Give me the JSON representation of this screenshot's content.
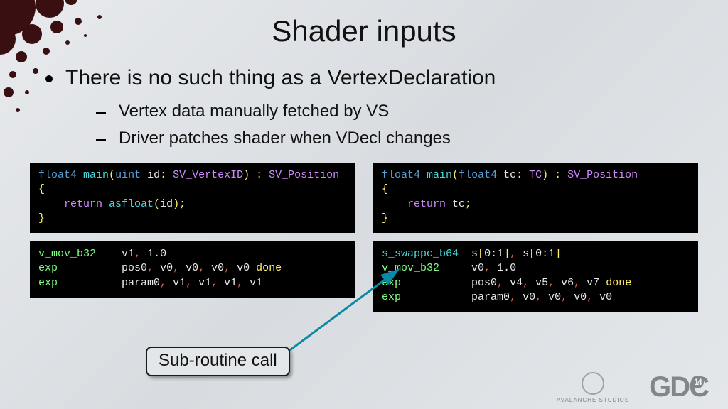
{
  "title": "Shader inputs",
  "main_bullet": "There is no such thing as a VertexDeclaration",
  "sub_bullets": [
    "Vertex data manually fetched by VS",
    "Driver patches shader when VDecl changes"
  ],
  "code": {
    "left_hlsl": {
      "sig_type1": "float4",
      "sig_name": "main",
      "sig_open": "(",
      "sig_argtype": "uint",
      "sig_argname": " id",
      "sig_colon1": ": ",
      "sig_sem1": "SV_VertexID",
      "sig_close": ") ",
      "sig_colon2": ": ",
      "sig_sem2": "SV_Position",
      "open_brace": "{",
      "ret_kw": "    return ",
      "ret_fn": "asfloat",
      "ret_open": "(",
      "ret_arg": "id",
      "ret_close": ");",
      "close_brace": "}"
    },
    "left_asm": {
      "l1_op": "v_mov_b32",
      "l1_sp": "    ",
      "l1_r": "v1",
      "l1_v": "1.0",
      "l2_op": "exp",
      "l2_sp": "          ",
      "l2_a": "pos0",
      "l2_b": "v0",
      "l2_c": "v0",
      "l2_d": "v0",
      "l2_e": "v0",
      "l2_done": " done",
      "l3_op": "exp",
      "l3_sp": "          ",
      "l3_a": "param0",
      "l3_b": "v1",
      "l3_c": "v1",
      "l3_d": "v1",
      "l3_e": "v1"
    },
    "right_hlsl": {
      "sig_type1": "float4",
      "sig_name": "main",
      "sig_open": "(",
      "sig_argtype": "float4",
      "sig_argname": " tc",
      "sig_colon1": ": ",
      "sig_sem1": "TC",
      "sig_close": ") ",
      "sig_colon2": ": ",
      "sig_sem2": "SV_Position",
      "open_brace": "{",
      "ret_kw": "    return ",
      "ret_arg": "tc",
      "ret_close": ";",
      "close_brace": "}"
    },
    "right_asm": {
      "l1_op": "s_swappc_b64",
      "l1_sp": "  ",
      "l1_a": "s",
      "l1_ao": "[",
      "l1_ar": "0:1",
      "l1_ac": "]",
      "l1_b": "s",
      "l1_bo": "[",
      "l1_br": "0:1",
      "l1_bc": "]",
      "l2_op": "v_mov_b32",
      "l2_sp": "     ",
      "l2_r": "v0",
      "l2_v": "1.0",
      "l3_op": "exp",
      "l3_sp": "           ",
      "l3_a": "pos0",
      "l3_b": "v4",
      "l3_c": "v5",
      "l3_d": "v6",
      "l3_e": "v7",
      "l3_done": " done",
      "l4_op": "exp",
      "l4_sp": "           ",
      "l4_a": "param0",
      "l4_b": "v0",
      "l4_c": "v0",
      "l4_d": "v0",
      "l4_e": "v0"
    }
  },
  "callout": "Sub-routine call",
  "logos": {
    "avalanche": "AVALANCHE STUDIOS",
    "gdc": "GDC",
    "gdc_year": "14"
  }
}
